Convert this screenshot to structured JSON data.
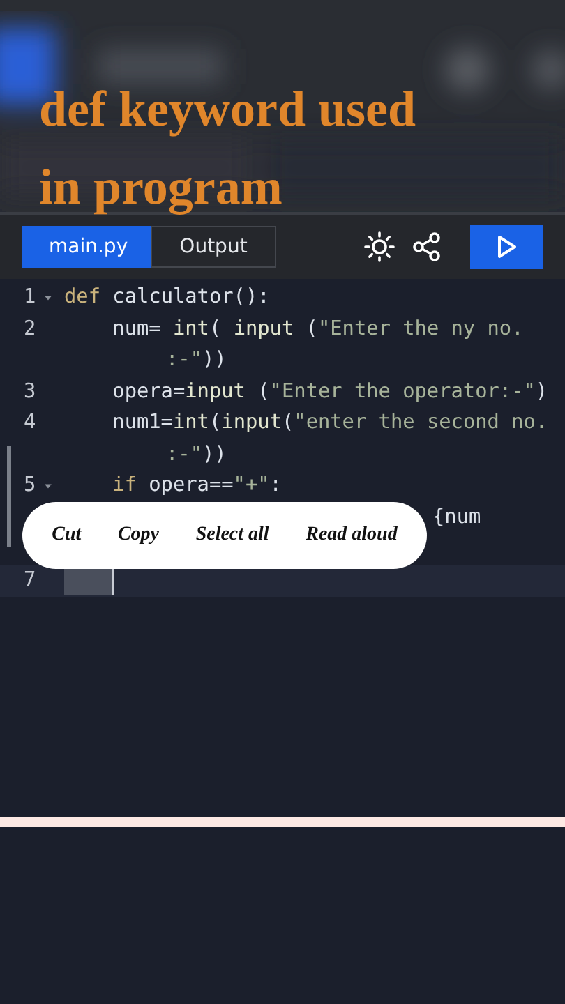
{
  "overlay_title": "def keyword used in program",
  "tabs": [
    {
      "label": "main.py",
      "selected": true
    },
    {
      "label": "Output",
      "selected": false
    }
  ],
  "code_lines": [
    {
      "number": "1",
      "foldable": true,
      "active": false,
      "rows": [
        {
          "tokens": [
            {
              "kind": "kw",
              "text": "def"
            },
            {
              "kind": "plain",
              "text": " calculator():"
            }
          ]
        }
      ]
    },
    {
      "number": "2",
      "foldable": false,
      "active": false,
      "rows": [
        {
          "tokens": [
            {
              "kind": "plain",
              "text": "    num= "
            },
            {
              "kind": "fn",
              "text": "int"
            },
            {
              "kind": "plain",
              "text": "( "
            },
            {
              "kind": "fn",
              "text": "input"
            },
            {
              "kind": "plain",
              "text": " ("
            },
            {
              "kind": "str",
              "text": "\"Enter the ny no."
            }
          ]
        },
        {
          "tokens": [
            {
              "kind": "str",
              "text": ":-\""
            },
            {
              "kind": "plain",
              "text": "))"
            }
          ]
        }
      ]
    },
    {
      "number": "3",
      "foldable": false,
      "active": false,
      "rows": [
        {
          "tokens": [
            {
              "kind": "plain",
              "text": "    opera="
            },
            {
              "kind": "fn",
              "text": "input"
            },
            {
              "kind": "plain",
              "text": " ("
            },
            {
              "kind": "str",
              "text": "\"Enter the operator:-\""
            },
            {
              "kind": "plain",
              "text": ")"
            }
          ]
        }
      ]
    },
    {
      "number": "4",
      "foldable": false,
      "active": false,
      "rows": [
        {
          "tokens": [
            {
              "kind": "plain",
              "text": "    num1="
            },
            {
              "kind": "fn",
              "text": "int"
            },
            {
              "kind": "plain",
              "text": "("
            },
            {
              "kind": "fn",
              "text": "input"
            },
            {
              "kind": "plain",
              "text": "("
            },
            {
              "kind": "str",
              "text": "\"enter the second no."
            }
          ]
        },
        {
          "tokens": [
            {
              "kind": "str",
              "text": ":-\""
            },
            {
              "kind": "plain",
              "text": "))"
            }
          ]
        }
      ]
    },
    {
      "number": "5",
      "foldable": true,
      "active": false,
      "rows": [
        {
          "tokens": [
            {
              "kind": "kw",
              "text": "    if"
            },
            {
              "kind": "plain",
              "text": " opera=="
            },
            {
              "kind": "str",
              "text": "\"+\""
            },
            {
              "kind": "plain",
              "text": ":"
            }
          ]
        }
      ]
    },
    {
      "foldable": false,
      "active": false,
      "rows": [
        {
          "tokens": [
            {
              "kind": "plain",
              "text": "{num"
            }
          ]
        },
        {
          "tokens": []
        }
      ]
    },
    {
      "number": "7",
      "foldable": false,
      "active": true,
      "rows": [
        {
          "tokens": []
        }
      ]
    }
  ],
  "context_menu": [
    "Cut",
    "Copy",
    "Select all",
    "Read aloud"
  ]
}
